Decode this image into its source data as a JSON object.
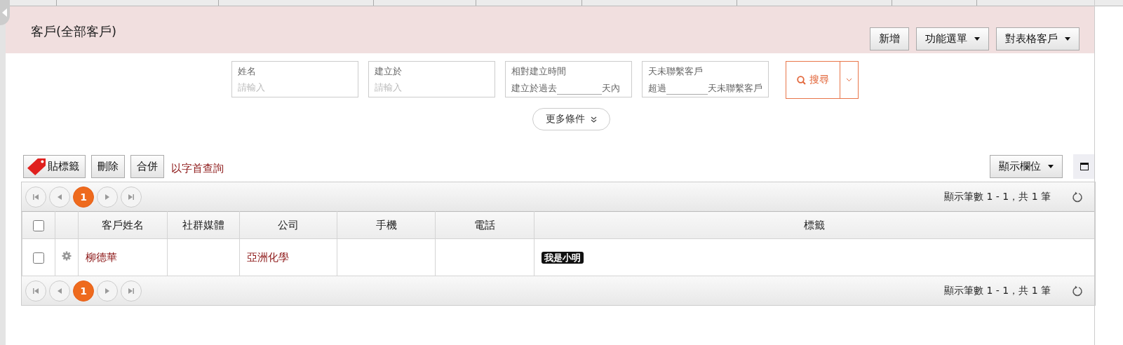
{
  "header": {
    "title": "客戶(全部客戶)",
    "buttons": [
      {
        "label": "新增",
        "kind": "plain"
      },
      {
        "label": "功能選單",
        "kind": "dropdown"
      },
      {
        "label": "對表格客戶",
        "kind": "dropdown"
      }
    ]
  },
  "filters": [
    {
      "kind": "text",
      "label": "姓名",
      "placeholder": "請輸入"
    },
    {
      "kind": "text",
      "label": "建立於",
      "placeholder": "請輸入"
    },
    {
      "kind": "range",
      "label": "相對建立時間",
      "prefix": "建立於過去",
      "suffix": "天內"
    },
    {
      "kind": "range",
      "label": "天未聯繫客戶",
      "prefix": "超過",
      "suffix": "天未聯繫客戶"
    }
  ],
  "search_button": {
    "label": "搜尋"
  },
  "more_conditions": {
    "label": "更多條件"
  },
  "toolbar": {
    "buttons": [
      {
        "label": "貼標籤",
        "kind": "tag"
      },
      {
        "label": "刪除",
        "kind": "plain"
      },
      {
        "label": "合併",
        "kind": "plain"
      }
    ],
    "link": "以字首查詢",
    "columns_button": "顯示欄位"
  },
  "pager_top": {
    "pages": [
      {
        "label": "1",
        "selected": true
      }
    ],
    "summary": "顯示筆數 1 - 1，共 1 筆"
  },
  "table": {
    "select_all": {
      "checked": false
    },
    "columns": [
      "客戶姓名",
      "社群媒體",
      "公司",
      "手機",
      "電話",
      "標籤"
    ],
    "rows": [
      {
        "checked": false,
        "name": "柳德華",
        "social": "",
        "company": "亞洲化學",
        "mobile": "",
        "phone": "",
        "tags": [
          "我是小明"
        ]
      }
    ]
  },
  "pager_bottom": {
    "pages": [
      {
        "label": "1",
        "selected": true
      }
    ],
    "summary": "顯示筆數 1 - 1，共 1 筆"
  }
}
